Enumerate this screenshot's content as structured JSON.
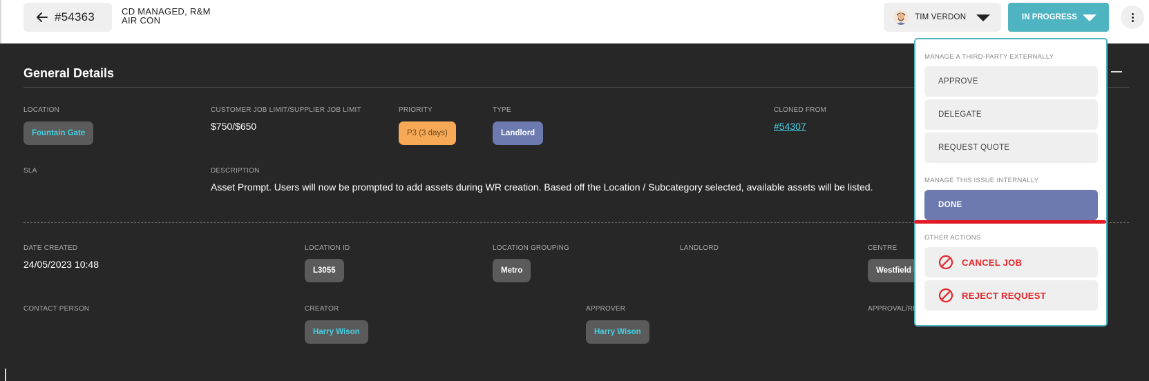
{
  "header": {
    "job_number": "#54363",
    "title_line1": "CD MANAGED, R&M",
    "title_line2": "AIR CON",
    "assignee": "TIM VERDON",
    "status": "IN PROGRESS",
    "icons": {
      "back": "arrow-left-icon",
      "assignee_caret": "chevron-down-icon",
      "status_caret": "chevron-down-icon",
      "more": "more-vertical-icon"
    },
    "accent_color": "#4fb4c1"
  },
  "general": {
    "title": "General Details",
    "location_label": "LOCATION",
    "location_value": "Fountain Gate",
    "limit_label": "CUSTOMER JOB LIMIT/SUPPLIER JOB LIMIT",
    "limit_value": "$750/$650",
    "priority_label": "PRIORITY",
    "priority_value": "P3 (3 days)",
    "type_label": "TYPE",
    "type_value": "Landlord",
    "cloned_label": "CLONED FROM",
    "cloned_value": "#54307",
    "sla_label": "SLA",
    "description_label": "DESCRIPTION",
    "description_value": "Asset Prompt. Users will now be prompted to add assets during WR creation. Based off the Location / Subcategory selected, available assets will be listed."
  },
  "details": {
    "date_created_label": "DATE CREATED",
    "date_created_value": "24/05/2023 10:48",
    "location_id_label": "LOCATION ID",
    "location_id_value": "L3055",
    "location_grouping_label": "LOCATION GROUPING",
    "location_grouping_value": "Metro",
    "landlord_label": "LANDLORD",
    "centre_label": "CENTRE",
    "centre_value": "Westfield I",
    "contact_label": "CONTACT PERSON",
    "creator_label": "CREATOR",
    "creator_value": "Harry Wison",
    "approver_label": "APPROVER",
    "approver_value": "Harry Wison",
    "approval_label": "APPROVAL/RE"
  },
  "dropdown": {
    "external_heading": "MANAGE A THIRD-PARTY EXTERNALLY",
    "approve": "APPROVE",
    "delegate": "DELEGATE",
    "request_quote": "REQUEST QUOTE",
    "internal_heading": "MANAGE THIS ISSUE INTERNALLY",
    "done": "DONE",
    "other_heading": "OTHER ACTIONS",
    "cancel_job": "CANCEL JOB",
    "reject_request": "REJECT REQUEST",
    "danger_color": "#e5252a",
    "done_color": "#6c7ab0"
  }
}
